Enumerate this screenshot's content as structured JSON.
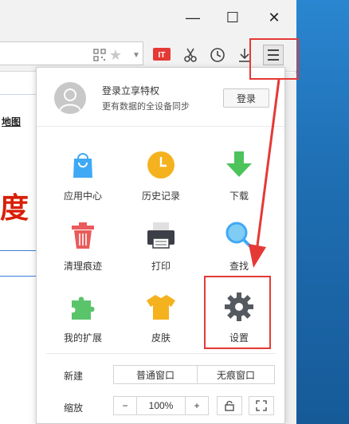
{
  "window": {
    "minimize_glyph": "—",
    "maximize_glyph": "☐",
    "close_glyph": "✕"
  },
  "page": {
    "link_map": "地图",
    "logo_fragment": "度"
  },
  "menu": {
    "login_title": "登录立享特权",
    "login_subtitle": "更有数据的全设备同步",
    "login_button": "登录",
    "items": [
      {
        "label": "应用中心",
        "icon": "app-center-icon"
      },
      {
        "label": "历史记录",
        "icon": "history-icon"
      },
      {
        "label": "下载",
        "icon": "download-icon"
      },
      {
        "label": "清理痕迹",
        "icon": "trash-icon"
      },
      {
        "label": "打印",
        "icon": "printer-icon"
      },
      {
        "label": "查找",
        "icon": "search-icon"
      },
      {
        "label": "我的扩展",
        "icon": "puzzle-icon"
      },
      {
        "label": "皮肤",
        "icon": "shirt-icon"
      },
      {
        "label": "设置",
        "icon": "gear-icon"
      }
    ],
    "new_label": "新建",
    "new_normal": "普通窗口",
    "new_incognito": "无痕窗口",
    "zoom_label": "缩放",
    "zoom_minus": "−",
    "zoom_value": "100%",
    "zoom_plus": "+"
  },
  "colors": {
    "annotation_red": "#e53935",
    "logo_red": "#d81e06"
  }
}
